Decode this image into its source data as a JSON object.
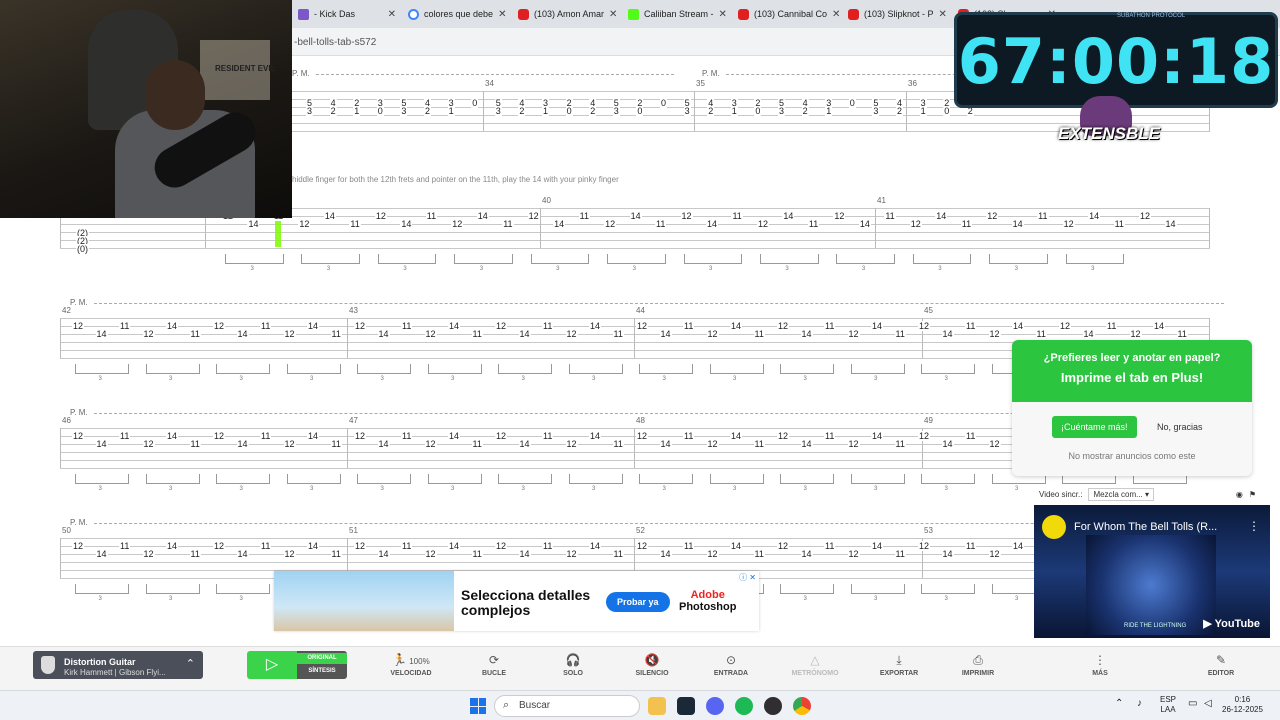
{
  "browser": {
    "tabs": [
      {
        "title": "- Kick Das",
        "icon": "tab-icon"
      },
      {
        "title": "colores que debe",
        "icon": "google-icon"
      },
      {
        "title": "(103) Amon Amar",
        "icon": "youtube-icon"
      },
      {
        "title": "Caliiban Stream -",
        "icon": "kick-icon"
      },
      {
        "title": "(103) Cannibal Co",
        "icon": "youtube-icon"
      },
      {
        "title": "(103) Slipknot - P",
        "icon": "youtube-icon"
      },
      {
        "title": "(103) Sl",
        "icon": "youtube-icon"
      }
    ],
    "url": "-bell-tolls-tab-s572"
  },
  "overlay": {
    "timer": "67:00:18",
    "timer_caption": "SUBATHON PROTOCOL",
    "logo_text": "EXTENSBLE"
  },
  "webcam": {
    "poster_text": "RESIDENT EVIL"
  },
  "tab": {
    "tip": "hiddle finger for both the 12th frets and pointer on the 11th, play the 14 with your pinky finger",
    "pm_label": "P. M.",
    "tuning": [
      "(2)",
      "(2)",
      "(0)"
    ],
    "measure_numbers": {
      "row1": [
        "34",
        "35",
        "36"
      ],
      "row2": [
        "40",
        "41"
      ],
      "row3": [
        "42",
        "43",
        "44",
        "45"
      ],
      "row4": [
        "46",
        "47",
        "48",
        "49"
      ],
      "row5": [
        "50",
        "51",
        "52",
        "53"
      ]
    },
    "row1_chords": [
      [
        "5",
        "3"
      ],
      [
        "4",
        "2"
      ],
      [
        "2",
        "1"
      ],
      [
        "3",
        "0"
      ],
      [
        "5",
        "3"
      ],
      [
        "4",
        "2"
      ],
      [
        "3",
        "1"
      ],
      [
        "0"
      ],
      [
        "5",
        "3"
      ],
      [
        "4",
        "2"
      ],
      [
        "3",
        "1"
      ],
      [
        "2",
        "0"
      ],
      [
        "4",
        "2"
      ],
      [
        "5",
        "3"
      ],
      [
        "2",
        "0"
      ],
      [
        "0"
      ],
      [
        "5",
        "3"
      ],
      [
        "4",
        "2"
      ],
      [
        "3",
        "1"
      ],
      [
        "2",
        "0"
      ],
      [
        "5",
        "3"
      ],
      [
        "4",
        "2"
      ],
      [
        "3",
        "1"
      ],
      [
        "0"
      ],
      [
        "5",
        "3"
      ],
      [
        "4",
        "2"
      ],
      [
        "3",
        "1"
      ],
      [
        "2",
        "0"
      ],
      [
        "4",
        "2"
      ]
    ],
    "riff_pattern": [
      "12",
      "14",
      "11",
      "12",
      "14",
      "11"
    ]
  },
  "promo": {
    "question": "¿Prefieres leer y anotar en papel?",
    "cta": "Imprime el tab en Plus!",
    "yes_label": "¡Cuéntame más!",
    "no_label": "No, gracias",
    "hide_label": "No mostrar anuncios como este"
  },
  "video_sync": {
    "label": "Video sincr.:",
    "selected": "Mezcla com...",
    "video_title": "For Whom The Bell Tolls (R...",
    "album_caption": "RIDE THE LIGHTNING",
    "provider": "YouTube"
  },
  "ad": {
    "headline": "Selecciona detalles complejos",
    "button": "Probar ya",
    "brand_line1": "Adobe",
    "brand_line2": "Photoshop"
  },
  "toolbar": {
    "track_name": "Distortion Guitar",
    "track_sub": "Kirk Hammett | Gibson Flyi...",
    "mode_original": "ORIGINAL",
    "mode_synth": "SÍNTESIS",
    "speed_value": "100%",
    "items": [
      {
        "label": "VELOCIDAD",
        "icon": "runner-icon"
      },
      {
        "label": "BUCLE",
        "icon": "loop-icon"
      },
      {
        "label": "SOLO",
        "icon": "headphones-icon"
      },
      {
        "label": "SILENCIO",
        "icon": "mute-icon"
      },
      {
        "label": "ENTRADA",
        "icon": "countin-icon"
      },
      {
        "label": "METRÓNOMO",
        "icon": "metronome-icon"
      },
      {
        "label": "EXPORTAR",
        "icon": "download-icon"
      },
      {
        "label": "IMPRIMIR",
        "icon": "printer-icon"
      },
      {
        "label": "MÁS",
        "icon": "more-icon"
      },
      {
        "label": "EDITOR",
        "icon": "pencil-icon"
      }
    ]
  },
  "taskbar": {
    "search_placeholder": "Buscar",
    "lang_line1": "ESP",
    "lang_line2": "LAA",
    "time": "0:16",
    "date": "26-12-2025"
  }
}
